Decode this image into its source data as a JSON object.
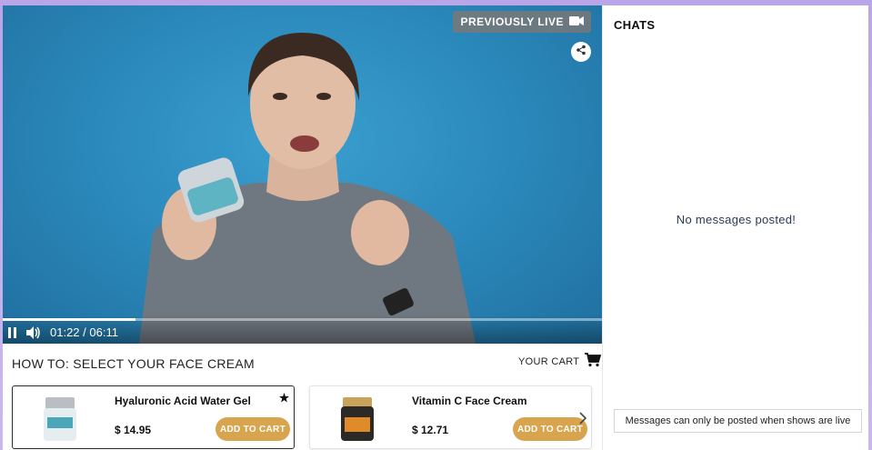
{
  "video": {
    "badge_label": "PREVIOUSLY LIVE",
    "time_display": "01:22 / 06:11",
    "progress_fraction": 0.222
  },
  "show": {
    "title": "HOW TO: SELECT YOUR FACE CREAM",
    "cart_label": "YOUR CART"
  },
  "products": [
    {
      "name": "Hyaluronic Acid Water Gel",
      "price": "$ 14.95",
      "button": "ADD TO CART"
    },
    {
      "name": "Vitamin C Face Cream",
      "price": "$ 12.71",
      "button": "ADD TO CART"
    }
  ],
  "chat": {
    "title": "CHATS",
    "empty_message": "No messages posted!",
    "notice": "Messages can only be posted when shows are live"
  },
  "colors": {
    "accent_button": "#d9a44e",
    "video_bg": "#2a86b8"
  }
}
